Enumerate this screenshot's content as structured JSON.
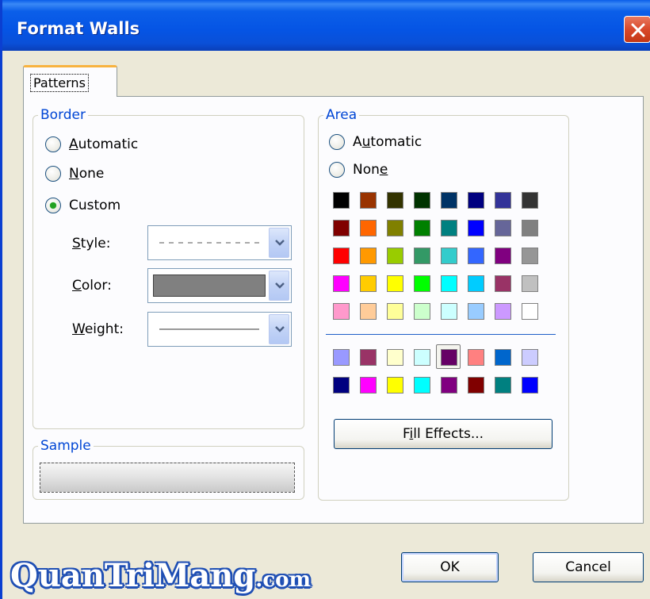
{
  "window": {
    "title": "Format Walls"
  },
  "tabs": [
    {
      "label": "Patterns",
      "active": true
    }
  ],
  "border": {
    "title": "Border",
    "options": [
      {
        "pre": "",
        "key": "A",
        "post": "utomatic",
        "checked": false
      },
      {
        "pre": "",
        "key": "N",
        "post": "one",
        "checked": false
      },
      {
        "pre": "Custom",
        "key": "",
        "post": "",
        "checked": true
      }
    ],
    "style_label": {
      "key": "S",
      "rest": "tyle:"
    },
    "color_label": {
      "key": "C",
      "rest": "olor:"
    },
    "weight_label": {
      "key": "W",
      "rest": "eight:"
    },
    "style_value": "dashed",
    "color_value": "#808080",
    "weight_value": "thin"
  },
  "sample": {
    "title": "Sample"
  },
  "area": {
    "title": "Area",
    "options": [
      {
        "pre": "A",
        "key": "u",
        "post": "tomatic",
        "checked": false
      },
      {
        "pre": "Non",
        "key": "e",
        "post": "",
        "checked": false
      }
    ],
    "palette_rows": [
      [
        "#000000",
        "#993300",
        "#333300",
        "#003300",
        "#003366",
        "#000080",
        "#333399",
        "#333333"
      ],
      [
        "#800000",
        "#ff6600",
        "#808000",
        "#008000",
        "#008080",
        "#0000ff",
        "#666699",
        "#808080"
      ],
      [
        "#ff0000",
        "#ff9900",
        "#99cc00",
        "#339966",
        "#33cccc",
        "#3366ff",
        "#800080",
        "#969696"
      ],
      [
        "#ff00ff",
        "#ffcc00",
        "#ffff00",
        "#00ff00",
        "#00ffff",
        "#00ccff",
        "#993366",
        "#c0c0c0"
      ],
      [
        "#ff99cc",
        "#ffcc99",
        "#ffff99",
        "#ccffcc",
        "#ccffff",
        "#99ccff",
        "#cc99ff",
        "#ffffff"
      ]
    ],
    "chart_rows": [
      [
        "#9999ff",
        "#993366",
        "#ffffcc",
        "#ccffff",
        "#660066",
        "#ff8080",
        "#0066cc",
        "#ccccff"
      ],
      [
        "#000080",
        "#ff00ff",
        "#ffff00",
        "#00ffff",
        "#800080",
        "#800000",
        "#008080",
        "#0000ff"
      ]
    ],
    "selected_color": "#660066",
    "fill_effects": {
      "pre": "F",
      "key": "i",
      "post": "ll Effects..."
    }
  },
  "buttons": {
    "ok": "OK",
    "cancel": "Cancel"
  },
  "watermark": {
    "main": "QuanTriMang",
    "suffix": ".com"
  }
}
